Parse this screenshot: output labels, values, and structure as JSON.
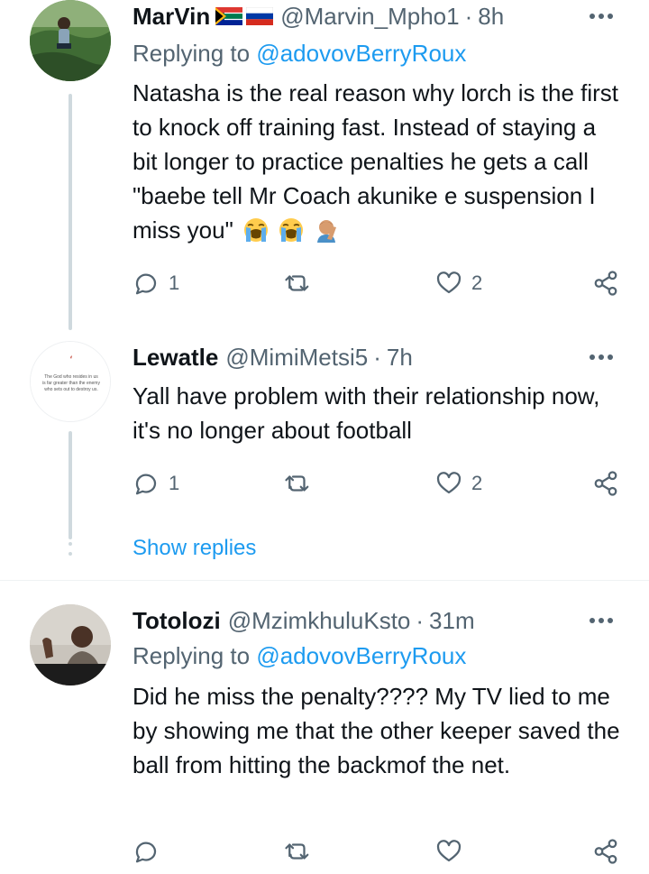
{
  "tweets": [
    {
      "name": "MarVin",
      "handle": "@Marvin_Mpho1",
      "sep": "·",
      "time": "8h",
      "replying_label": "Replying to ",
      "replying_mention": "@adovovBerryRoux",
      "text": "Natasha is the real reason why lorch is the first to knock off training fast. Instead of staying a bit longer to practice penalties he gets a call \"baebe tell Mr Coach akunike e suspension I miss you\"",
      "emojis": [
        "loudly-crying-face",
        "loudly-crying-face",
        "man-facepalming"
      ],
      "replies": "1",
      "likes": "2"
    },
    {
      "name": "Lewatle",
      "handle": "@MimiMetsi5",
      "sep": "·",
      "time": "7h",
      "avatar_text": "The God who resides in us is far greater than the enemy who sets out to destroy us.",
      "text": "Yall have problem with their relationship now, it's no longer about football",
      "replies": "1",
      "likes": "2",
      "show_replies": "Show replies"
    },
    {
      "name": "Totolozi",
      "handle": "@MzimkhuluKsto",
      "sep": "·",
      "time": "31m",
      "replying_label": "Replying to ",
      "replying_mention": "@adovovBerryRoux",
      "text": "Did he miss the penalty???? My TV lied to me by showing me that the other keeper saved the ball from hitting the backmof the net."
    }
  ],
  "colors": {
    "accent": "#1d9bf0",
    "secondary_text": "#536471",
    "thread_line": "#cfd9de"
  }
}
